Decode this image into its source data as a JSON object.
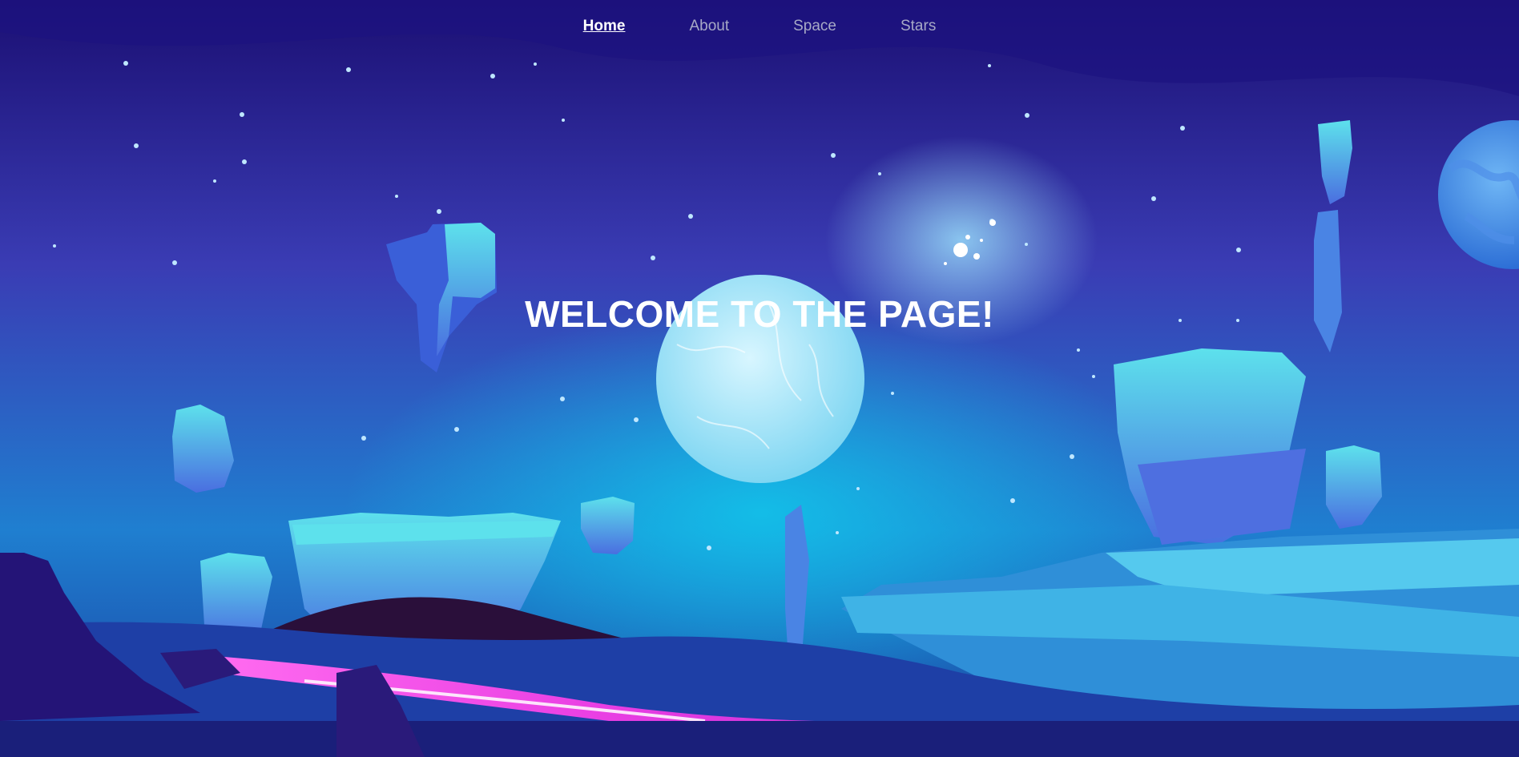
{
  "nav": {
    "items": [
      {
        "label": "Home",
        "active": true
      },
      {
        "label": "About",
        "active": false
      },
      {
        "label": "Space",
        "active": false
      },
      {
        "label": "Stars",
        "active": false
      }
    ]
  },
  "hero": {
    "headline": "WELCOME TO THE PAGE!"
  },
  "colors": {
    "sky_top": "#1b0f73",
    "sky_mid": "#3a3cb4",
    "sky_glow": "#1f8fd8",
    "ice_light": "#5de1ec",
    "ice_dark": "#3b5ad1",
    "lava": "#e640e0",
    "nav_inactive": "#a7a9c6",
    "nav_active": "#ffffff"
  }
}
